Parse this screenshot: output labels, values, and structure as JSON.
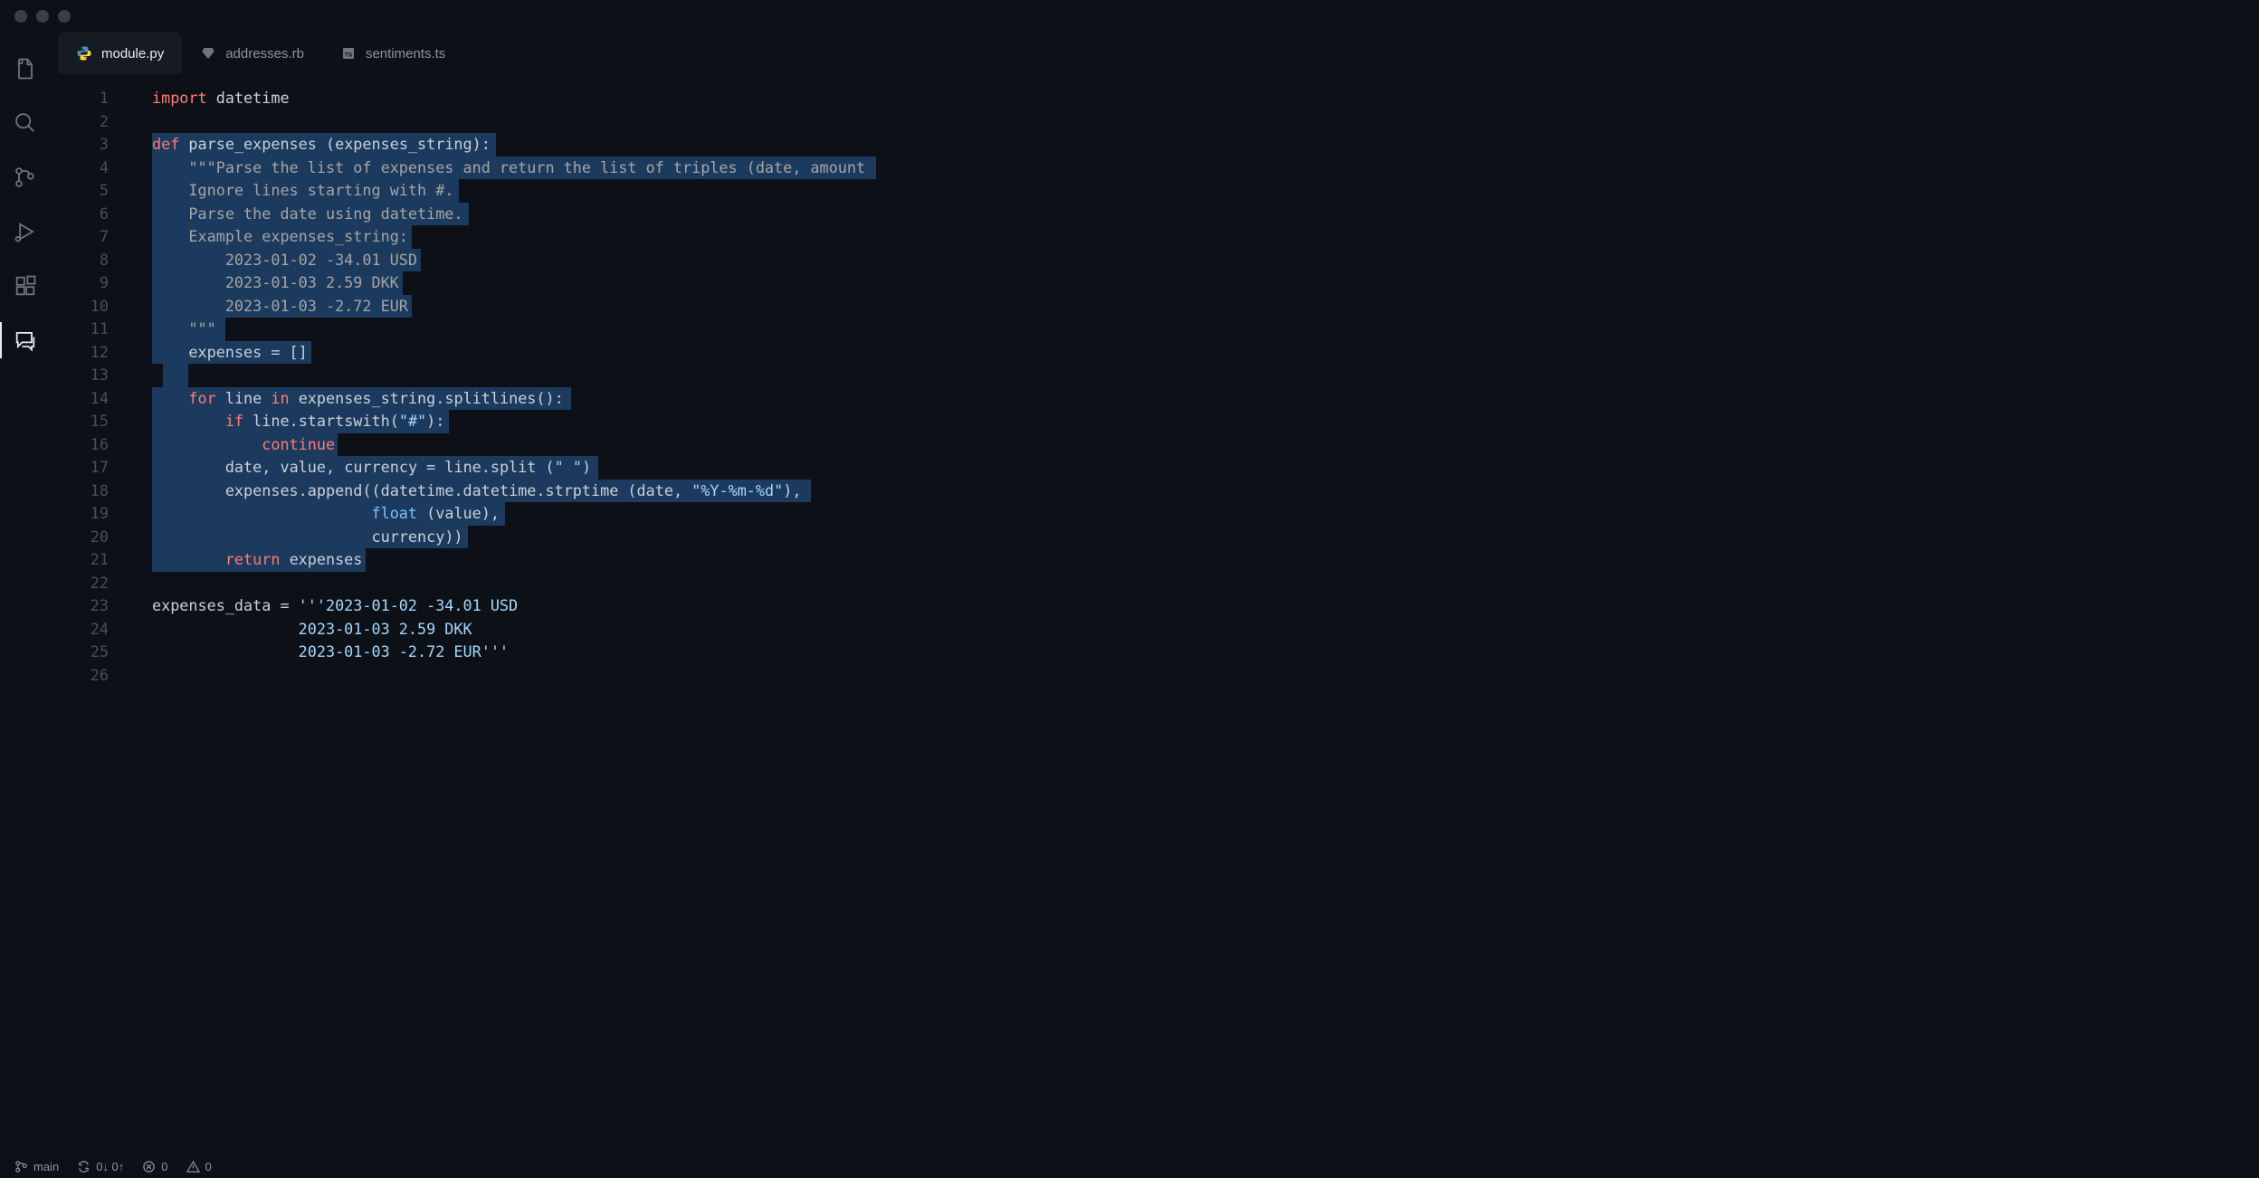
{
  "tabs": [
    {
      "label": "module.py",
      "icon": "python",
      "active": true
    },
    {
      "label": "addresses.rb",
      "icon": "ruby",
      "active": false
    },
    {
      "label": "sentiments.ts",
      "icon": "ts",
      "active": false
    }
  ],
  "statusbar": {
    "branch": "main",
    "sync": "0↓ 0↑",
    "errors": "0",
    "warnings": "0"
  },
  "code": {
    "lines": [
      {
        "n": 1,
        "sel": null,
        "tokens": [
          [
            "k-import",
            "import"
          ],
          [
            "punct",
            " "
          ],
          [
            "ident",
            "datetime"
          ]
        ]
      },
      {
        "n": 2,
        "sel": null,
        "tokens": []
      },
      {
        "n": 3,
        "sel": [
          0,
          37.6
        ],
        "tokens": [
          [
            "k-def",
            "def"
          ],
          [
            "punct",
            " "
          ],
          [
            "fn",
            "parse_expenses"
          ],
          [
            "punct",
            " ("
          ],
          [
            "ident",
            "expenses_string"
          ],
          [
            "punct",
            "):"
          ]
        ]
      },
      {
        "n": 4,
        "sel": [
          0,
          79.2
        ],
        "tokens": [
          [
            "punct",
            "    "
          ],
          [
            "doc",
            "\"\"\"Parse the list of expenses and return the list of triples (date, amount"
          ]
        ]
      },
      {
        "n": 5,
        "sel": [
          0,
          33.6
        ],
        "tokens": [
          [
            "punct",
            "    "
          ],
          [
            "doc",
            "Ignore lines starting with #."
          ]
        ]
      },
      {
        "n": 6,
        "sel": [
          0,
          34.7
        ],
        "tokens": [
          [
            "punct",
            "    "
          ],
          [
            "doc",
            "Parse the date using datetime."
          ]
        ]
      },
      {
        "n": 7,
        "sel": [
          0,
          28.4
        ],
        "tokens": [
          [
            "punct",
            "    "
          ],
          [
            "doc",
            "Example expenses_string:"
          ]
        ]
      },
      {
        "n": 8,
        "sel": [
          0,
          29.4
        ],
        "tokens": [
          [
            "punct",
            "        "
          ],
          [
            "doc",
            "2023-01-02 -34.01 USD"
          ]
        ]
      },
      {
        "n": 9,
        "sel": [
          0,
          27.4
        ],
        "tokens": [
          [
            "punct",
            "        "
          ],
          [
            "doc",
            "2023-01-03 2.59 DKK"
          ]
        ]
      },
      {
        "n": 10,
        "sel": [
          0,
          28.4
        ],
        "tokens": [
          [
            "punct",
            "        "
          ],
          [
            "doc",
            "2023-01-03 -2.72 EUR"
          ]
        ]
      },
      {
        "n": 11,
        "sel": [
          0,
          8.0
        ],
        "tokens": [
          [
            "punct",
            "    "
          ],
          [
            "doc",
            "\"\"\""
          ]
        ]
      },
      {
        "n": 12,
        "sel": [
          0,
          17.4
        ],
        "tokens": [
          [
            "punct",
            "    "
          ],
          [
            "ident",
            "expenses"
          ],
          [
            "punct",
            " = []"
          ]
        ]
      },
      {
        "n": 13,
        "sel": [
          1.2,
          4.0
        ],
        "tokens": []
      },
      {
        "n": 14,
        "sel": [
          0,
          45.8
        ],
        "tokens": [
          [
            "punct",
            "    "
          ],
          [
            "k-for",
            "for"
          ],
          [
            "punct",
            " "
          ],
          [
            "ident",
            "line"
          ],
          [
            "punct",
            " "
          ],
          [
            "k-in",
            "in"
          ],
          [
            "punct",
            " "
          ],
          [
            "ident",
            "expenses_string"
          ],
          [
            "punct",
            "."
          ],
          [
            "fn",
            "splitlines"
          ],
          [
            "punct",
            "():"
          ]
        ]
      },
      {
        "n": 15,
        "sel": [
          0,
          32.5
        ],
        "tokens": [
          [
            "punct",
            "        "
          ],
          [
            "k-if",
            "if"
          ],
          [
            "punct",
            " "
          ],
          [
            "ident",
            "line"
          ],
          [
            "punct",
            "."
          ],
          [
            "fn",
            "startswith"
          ],
          [
            "punct",
            "("
          ],
          [
            "str",
            "\"#\""
          ],
          [
            "punct",
            "):"
          ]
        ]
      },
      {
        "n": 16,
        "sel": [
          0,
          20.3
        ],
        "tokens": [
          [
            "punct",
            "            "
          ],
          [
            "k-continue",
            "continue"
          ]
        ]
      },
      {
        "n": 17,
        "sel": [
          0,
          48.8
        ],
        "tokens": [
          [
            "punct",
            "        "
          ],
          [
            "ident",
            "date"
          ],
          [
            "punct",
            ", "
          ],
          [
            "ident",
            "value"
          ],
          [
            "punct",
            ", "
          ],
          [
            "ident",
            "currency"
          ],
          [
            "punct",
            " = "
          ],
          [
            "ident",
            "line"
          ],
          [
            "punct",
            "."
          ],
          [
            "fn",
            "split"
          ],
          [
            "punct",
            " ("
          ],
          [
            "str",
            "\" \""
          ],
          [
            "punct",
            ")"
          ]
        ]
      },
      {
        "n": 18,
        "sel": [
          0,
          72.1
        ],
        "tokens": [
          [
            "punct",
            "        "
          ],
          [
            "ident",
            "expenses"
          ],
          [
            "punct",
            "."
          ],
          [
            "fn",
            "append"
          ],
          [
            "punct",
            "(("
          ],
          [
            "ident",
            "datetime"
          ],
          [
            "punct",
            "."
          ],
          [
            "ident",
            "datetime"
          ],
          [
            "punct",
            "."
          ],
          [
            "fn",
            "strptime"
          ],
          [
            "punct",
            " ("
          ],
          [
            "ident",
            "date"
          ],
          [
            "punct",
            ", "
          ],
          [
            "str",
            "\"%Y-%m-%d\""
          ],
          [
            "punct",
            "),"
          ]
        ]
      },
      {
        "n": 19,
        "sel": [
          0,
          38.6
        ],
        "tokens": [
          [
            "punct",
            "                        "
          ],
          [
            "builtin",
            "float"
          ],
          [
            "punct",
            " ("
          ],
          [
            "ident",
            "value"
          ],
          [
            "punct",
            "),"
          ]
        ]
      },
      {
        "n": 20,
        "sel": [
          0,
          34.6
        ],
        "tokens": [
          [
            "punct",
            "                        "
          ],
          [
            "ident",
            "currency"
          ],
          [
            "punct",
            "))"
          ]
        ]
      },
      {
        "n": 21,
        "sel": [
          0,
          23.4
        ],
        "tokens": [
          [
            "punct",
            "        "
          ],
          [
            "k-return",
            "return"
          ],
          [
            "punct",
            " "
          ],
          [
            "ident",
            "expenses"
          ]
        ]
      },
      {
        "n": 22,
        "sel": null,
        "tokens": []
      },
      {
        "n": 23,
        "sel": null,
        "tokens": [
          [
            "ident",
            "expenses_data"
          ],
          [
            "punct",
            " = "
          ],
          [
            "str",
            "'''2023-01-02 -34.01 USD"
          ]
        ]
      },
      {
        "n": 24,
        "sel": null,
        "tokens": [
          [
            "str",
            "                2023-01-03 2.59 DKK"
          ]
        ]
      },
      {
        "n": 25,
        "sel": null,
        "tokens": [
          [
            "str",
            "                2023-01-03 -2.72 EUR'''"
          ]
        ]
      },
      {
        "n": 26,
        "sel": null,
        "tokens": []
      }
    ]
  }
}
